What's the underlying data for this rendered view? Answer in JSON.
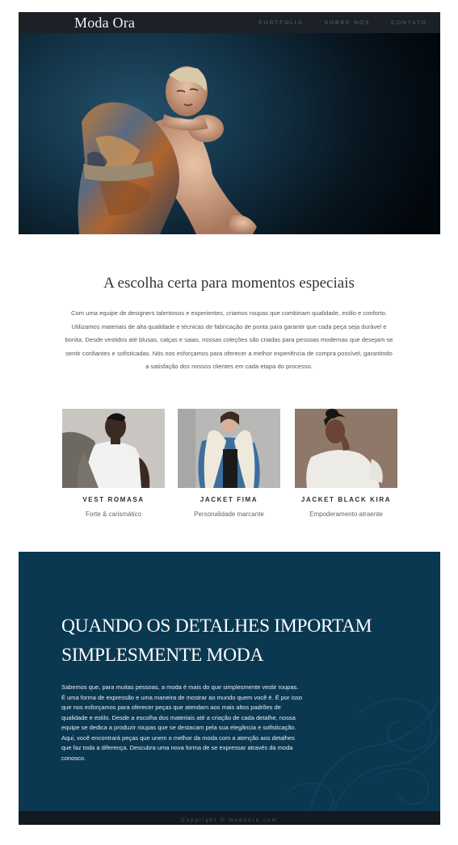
{
  "nav": {
    "brand": "Moda Ora",
    "links": [
      "PORTFOLIO",
      "SOBRE NÓS",
      "CONTATO"
    ]
  },
  "hero": {
    "image": "fashion-model-photo"
  },
  "intro": {
    "title": "A escolha certa para momentos especiais",
    "text": "Com uma equipe de designers talentosos e experientes, criamos roupas que combinam qualidade, estilo e conforto. Utilizamos materiais de alta qualidade e técnicas de fabricação de ponta para garantir que cada peça seja durável e bonita. Desde vestidos até blusas, calças e saias, nossas coleções são criadas para pessoas modernas que desejam se sentir confiantes e sofisticadas. Nós nos esforçamos para oferecer a melhor experiência de compra possível, garantindo a satisfação dos nossos clientes em cada etapa do processo."
  },
  "cards": [
    {
      "name": "VEST ROMASA",
      "subtitle": "Forte & carismático"
    },
    {
      "name": "JACKET FIMA",
      "subtitle": "Personalidade marcante"
    },
    {
      "name": "JACKET BLACK KIRA",
      "subtitle": "Empoderamento atraente"
    }
  ],
  "details": {
    "title_line1": "QUANDO OS DETALHES IMPORTAM",
    "title_line2": "SIMPLESMENTE MODA",
    "text": "Sabemos que, para muitas pessoas, a moda é mais do que simplesmente vestir roupas. É uma forma de expressão e uma maneira de mostrar ao mundo quem você é. É por isso que nos esforçamos para oferecer peças que atendam aos mais altos padrões de qualidade e estilo. Desde a escolha dos materiais até a criação de cada detalhe, nossa equipe se dedica a produzir roupas que se destacam pela sua elegância e sofisticação. Aqui, você encontrará peças que unem o melhor da moda com a atenção aos detalhes que faz toda a diferença. Descubra uma nova forma de se expressar através da moda conosco."
  },
  "footer": {
    "copyright": "Copyright © modaora.com"
  },
  "colors": {
    "nav_bg": "#1c2127",
    "accent_blue": "#0b3851",
    "footer_bg": "#131a20",
    "nav_link": "#4d6e7e"
  }
}
